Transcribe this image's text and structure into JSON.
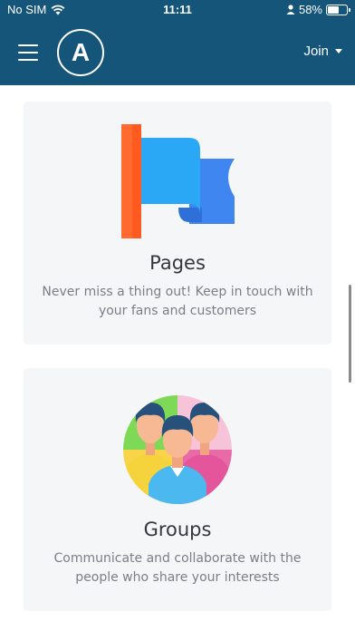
{
  "status": {
    "carrier": "No SIM",
    "time": "11:11",
    "battery": "58%",
    "battery_level": 0.58
  },
  "nav": {
    "logo_letter": "A",
    "join_label": "Join"
  },
  "cards": [
    {
      "title": "Pages",
      "description": "Never miss a thing out! Keep in touch with your fans and customers",
      "icon": "flag-icon"
    },
    {
      "title": "Groups",
      "description": "Communicate and collaborate with the people who share your interests",
      "icon": "people-group-icon"
    }
  ],
  "colors": {
    "header": "#16557a",
    "card_bg": "#f5f6f8",
    "title": "#333840",
    "text_muted": "#7a7f87"
  }
}
